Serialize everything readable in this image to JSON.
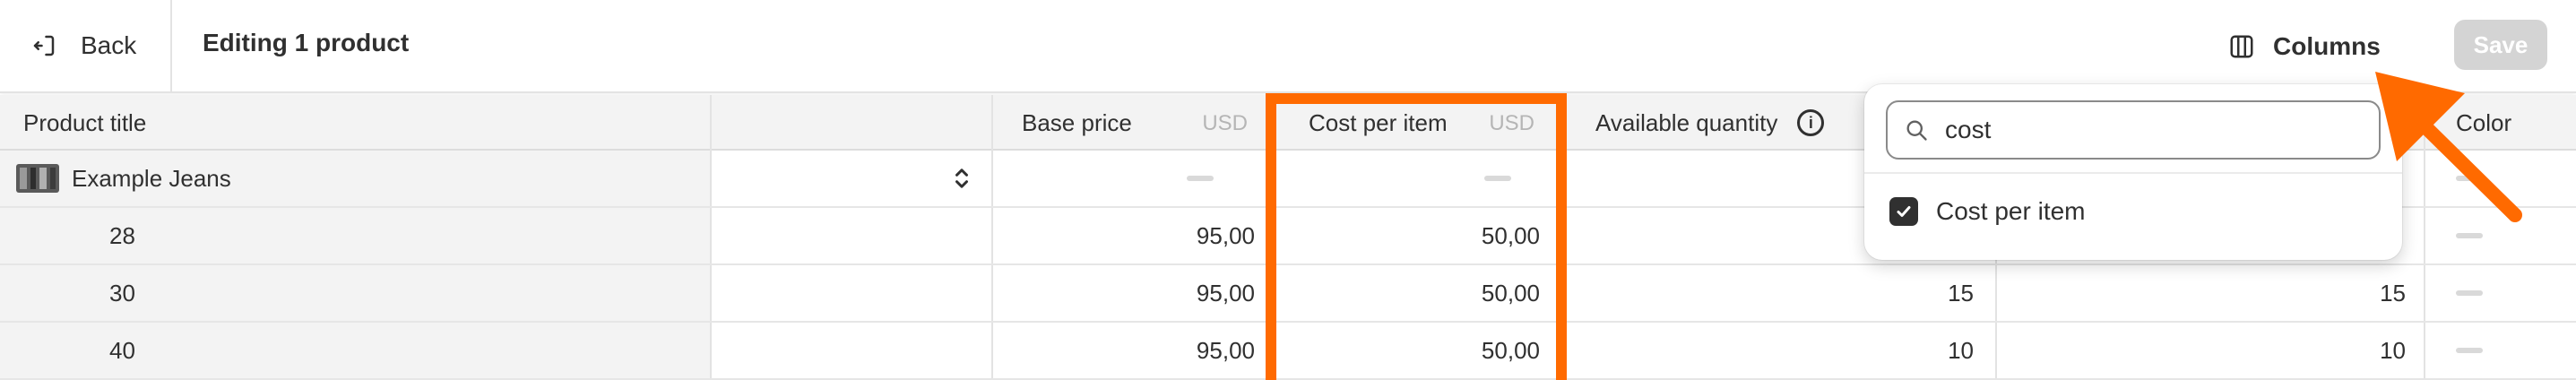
{
  "topbar": {
    "back_label": "Back",
    "title": "Editing 1 product",
    "columns_label": "Columns",
    "save_label": "Save"
  },
  "table": {
    "headers": {
      "product_title": "Product title",
      "base_price": "Base price",
      "base_price_currency": "USD",
      "cost_per_item": "Cost per item",
      "cost_per_item_currency": "USD",
      "available_quantity": "Available quantity",
      "color": "Color"
    },
    "rows": [
      {
        "title": "Example Jeans",
        "base_price": "",
        "cost": "",
        "qty": "",
        "qty2": ""
      },
      {
        "title": "28",
        "base_price": "95,00",
        "cost": "50,00",
        "qty": "",
        "qty2": ""
      },
      {
        "title": "30",
        "base_price": "95,00",
        "cost": "50,00",
        "qty": "15",
        "qty2": "15"
      },
      {
        "title": "40",
        "base_price": "95,00",
        "cost": "50,00",
        "qty": "10",
        "qty2": "10"
      }
    ]
  },
  "columns_popover": {
    "search_value": "cost",
    "items": [
      {
        "label": "Cost per item",
        "checked": true
      }
    ]
  },
  "colors": {
    "highlight": "#ff6a00",
    "checkbox": "#303030",
    "save_disabled": "#d4d4d4"
  },
  "icons": {
    "back": "exit-icon",
    "columns": "columns-icon",
    "search": "search-icon",
    "info": "info-icon",
    "select": "chevron-updown-icon",
    "check": "check-icon"
  }
}
